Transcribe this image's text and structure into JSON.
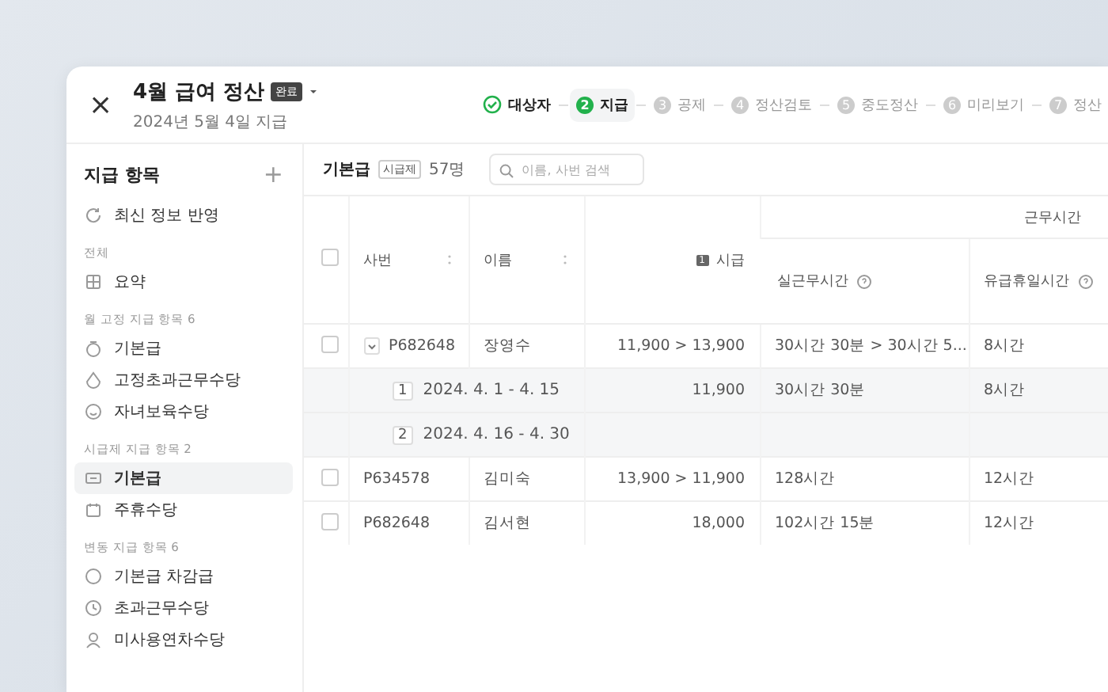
{
  "header": {
    "close": "×",
    "title": "4월 급여 정산",
    "badge": "완료",
    "subtitle": "2024년 5월 4일 지급",
    "steps": [
      {
        "label": "대상자",
        "completed": true,
        "selected": false
      },
      {
        "number": "2",
        "label": "지급",
        "completed": false,
        "selected": true
      },
      {
        "number": "3",
        "label": "공제",
        "completed": false,
        "selected": false
      },
      {
        "number": "4",
        "label": "정산검토",
        "completed": false,
        "selected": false
      },
      {
        "number": "5",
        "label": "중도정산",
        "completed": false,
        "selected": false
      },
      {
        "number": "6",
        "label": "미리보기",
        "completed": false,
        "selected": false
      },
      {
        "number": "7",
        "label": "정산",
        "completed": false,
        "selected": false
      }
    ]
  },
  "sidebar": {
    "title": "지급 항목",
    "add": "+",
    "refresh": "최신 정보 반영",
    "sections": [
      {
        "label": "전체",
        "items": [
          {
            "label": "요약",
            "selected": false
          }
        ]
      },
      {
        "label": "월 고정 지급 항목",
        "count": "6",
        "items": [
          {
            "label": "기본급",
            "selected": false
          },
          {
            "label": "고정초과근무수당",
            "selected": false
          },
          {
            "label": "자녀보육수당",
            "selected": false
          }
        ]
      },
      {
        "label": "시급제 지급 항목",
        "count": "2",
        "items": [
          {
            "label": "기본급",
            "selected": true
          },
          {
            "label": "주휴수당",
            "selected": false
          }
        ]
      },
      {
        "label": "변동 지급 항목",
        "count": "6",
        "items": [
          {
            "label": "기본급 차감급",
            "selected": false
          },
          {
            "label": "초과근무수당",
            "selected": false
          },
          {
            "label": "미사용연차수당",
            "selected": false
          }
        ]
      }
    ]
  },
  "table": {
    "title": "기본급",
    "tag": "시급제",
    "count": "57명",
    "search": {
      "placeholder": "이름, 사번 검색"
    },
    "select_all": {
      "checked": false
    },
    "columns": {
      "id": "사번",
      "name": "이름",
      "wage_badge": "1",
      "wage": "시급",
      "group": "근무시간",
      "hours": "실근무시간",
      "holiday": "유급휴일시간"
    },
    "rows": [
      {
        "kind": "group",
        "checked": false,
        "expanded": true,
        "id": "P682648",
        "name": "장영수",
        "wage": "11,900 > 13,900",
        "hours": "30시간 30분 > 30시간 5...",
        "holiday": "8시간"
      },
      {
        "kind": "period",
        "index": "1",
        "period": "2024. 4. 1 - 4. 15",
        "wage": "11,900",
        "hours": "30시간 30분",
        "holiday": "8시간"
      },
      {
        "kind": "period",
        "index": "2",
        "period": "2024. 4. 16 - 4. 30"
      },
      {
        "kind": "row",
        "checked": false,
        "id": "P634578",
        "name": "김미숙",
        "wage": "13,900 > 11,900",
        "hours": "128시간",
        "holiday": "12시간"
      },
      {
        "kind": "row",
        "checked": false,
        "id": "P682648",
        "name": "김서현",
        "wage": "18,000",
        "hours": "102시간 15분",
        "holiday": "12시간"
      }
    ]
  }
}
